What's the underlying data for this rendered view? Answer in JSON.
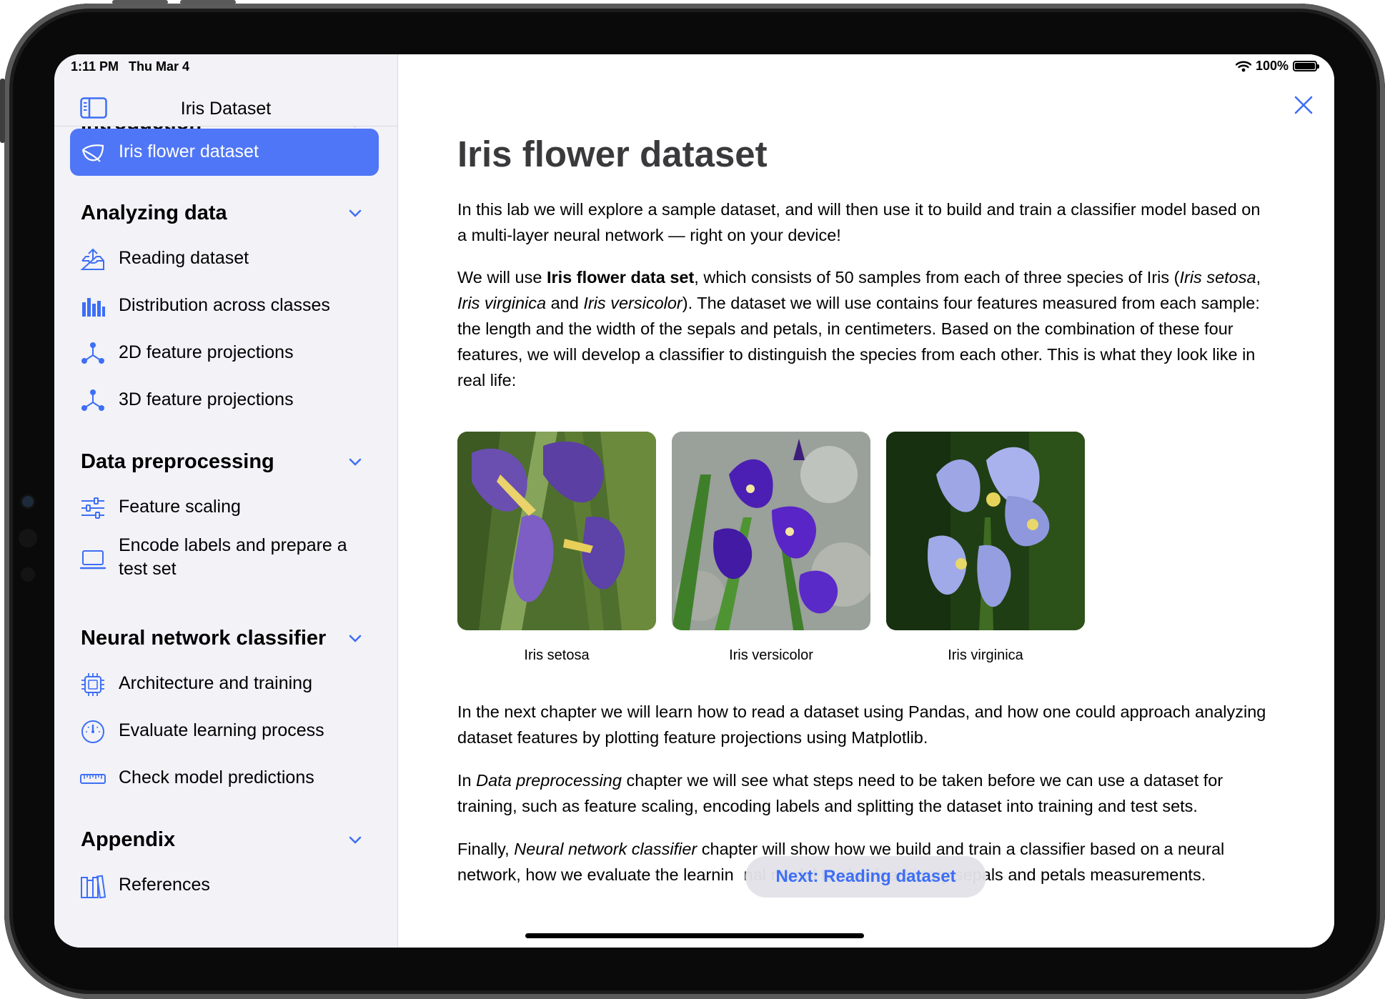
{
  "status_bar": {
    "time": "1:11 PM",
    "date": "Thu Mar 4",
    "battery": "100%"
  },
  "sidebar": {
    "title": "Iris Dataset",
    "sections": [
      {
        "title": "Introduction",
        "items": [
          {
            "label": "Iris flower dataset",
            "icon": "leaf-icon",
            "active": true
          }
        ]
      },
      {
        "title": "Analyzing data",
        "items": [
          {
            "label": "Reading dataset",
            "icon": "tray-upload-icon"
          },
          {
            "label": "Distribution across classes",
            "icon": "bar-chart-icon"
          },
          {
            "label": "2D feature projections",
            "icon": "point-topology-icon"
          },
          {
            "label": "3D feature projections",
            "icon": "point-topology-icon"
          }
        ]
      },
      {
        "title": "Data preprocessing",
        "items": [
          {
            "label": "Feature scaling",
            "icon": "sliders-icon"
          },
          {
            "label": "Encode labels and prepare a test set",
            "icon": "laptop-icon"
          }
        ]
      },
      {
        "title": "Neural network classifier",
        "items": [
          {
            "label": "Architecture and training",
            "icon": "cpu-icon"
          },
          {
            "label": "Evaluate learning process",
            "icon": "gauge-icon"
          },
          {
            "label": "Check model predictions",
            "icon": "ruler-icon"
          }
        ]
      },
      {
        "title": "Appendix",
        "items": [
          {
            "label": "References",
            "icon": "books-icon"
          }
        ]
      }
    ]
  },
  "content": {
    "title": "Iris flower dataset",
    "p1": "In this lab we will explore a sample dataset, and will then use it to build and train a classifier model based on a multi-layer neural network — right on your device!",
    "p2_a": "We will use ",
    "p2_bold": "Iris flower data set",
    "p2_b": ", which consists of 50 samples from each of three species of Iris (",
    "p2_i1": "Iris setosa",
    "p2_c": ", ",
    "p2_i2": "Iris virginica",
    "p2_d": " and ",
    "p2_i3": "Iris versicolor",
    "p2_e": "). The dataset we will use contains four features measured from each sample: the length and the width of the sepals and petals, in centimeters. Based on the combination of these four features, we will develop a classifier to distinguish the species from each other. This is what they look like in real life:",
    "figures": [
      {
        "caption": "Iris setosa"
      },
      {
        "caption": "Iris versicolor"
      },
      {
        "caption": "Iris virginica"
      }
    ],
    "p3": "In the next chapter we will learn how to read a dataset using Pandas, and how one could approach analyzing dataset features by plotting feature projections using Matplotlib.",
    "p4_a": "In ",
    "p4_i": "Data preprocessing",
    "p4_b": " chapter we will see what steps need to be taken before we can use a dataset for training, such as feature scaling, encoding labels and splitting the dataset into training and test sets.",
    "p5_a": "Finally, ",
    "p5_i": "Neural network classifier",
    "p5_b": " chapter will show how we build and train a classifier based on a neural network, how we evaluate the learnin",
    "p5_c": "nal model to check arbitrary sepals and petals measurements."
  },
  "next_button": "Next: Reading dataset",
  "colors": {
    "accent": "#4f76f6",
    "link": "#3d6ef5",
    "sidebar_bg": "#f2f2f7"
  }
}
